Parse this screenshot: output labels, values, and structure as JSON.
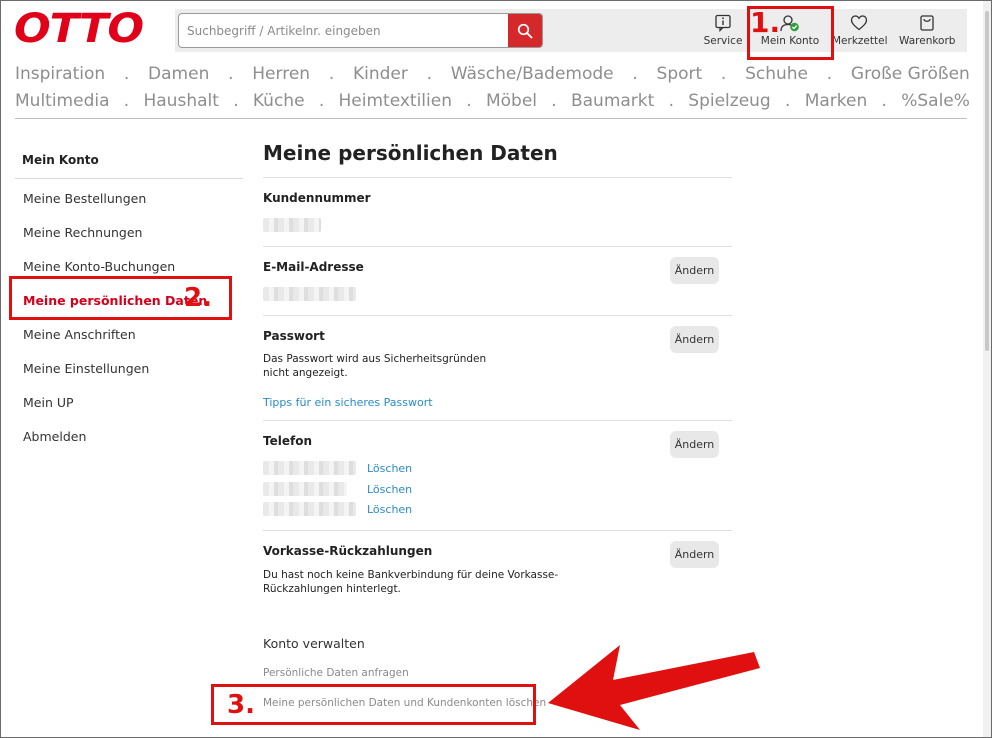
{
  "header": {
    "logo": "OTTO",
    "search_placeholder": "Suchbegriff / Artikelnr. eingeben",
    "items": [
      {
        "label": "Service",
        "icon": "info-icon"
      },
      {
        "label": "Mein Konto",
        "icon": "account-icon"
      },
      {
        "label": "Merkzettel",
        "icon": "heart-icon"
      },
      {
        "label": "Warenkorb",
        "icon": "bag-icon"
      }
    ]
  },
  "nav": {
    "row1": [
      "Inspiration",
      "Damen",
      "Herren",
      "Kinder",
      "Wäsche/Bademode",
      "Sport",
      "Schuhe",
      "Große Größen"
    ],
    "row2": [
      "Multimedia",
      "Haushalt",
      "Küche",
      "Heimtextilien",
      "Möbel",
      "Baumarkt",
      "Spielzeug",
      "Marken",
      "%Sale%"
    ],
    "separator": "."
  },
  "sidebar": {
    "title": "Mein Konto",
    "items": [
      "Meine Bestellungen",
      "Meine Rechnungen",
      "Meine Konto-Buchungen",
      "Meine persönlichen Daten",
      "Meine Anschriften",
      "Meine Einstellungen",
      "Mein UP",
      "Abmelden"
    ]
  },
  "main": {
    "title": "Meine persönlichen Daten",
    "kundennummer": "Kundennummer",
    "email": "E-Mail-Adresse",
    "passwort": "Passwort",
    "passwort_hint_1": "Das Passwort wird aus Sicherheitsgründen",
    "passwort_hint_2": "nicht angezeigt.",
    "passwort_tips": "Tipps für ein sicheres Passwort",
    "telefon": "Telefon",
    "loeschen": "Löschen",
    "vorkasse": "Vorkasse-Rückzahlungen",
    "vorkasse_hint_1": "Du hast noch keine Bankverbindung für deine Vorkasse-",
    "vorkasse_hint_2": "Rückzahlungen hinterlegt.",
    "aendern": "Ändern",
    "konto_verwalten": "Konto verwalten",
    "daten_anfragen": "Persönliche Daten anfragen",
    "daten_loeschen": "Meine persönlichen Daten und Kundenkonten löschen"
  },
  "annotations": {
    "step1": "1.",
    "step2": "2.",
    "step3": "3.",
    "color": "#e01010"
  },
  "colors": {
    "brand": "#e1001a",
    "search_button": "#d5282a",
    "link": "#2a8bc8",
    "active": "#d5001a"
  }
}
